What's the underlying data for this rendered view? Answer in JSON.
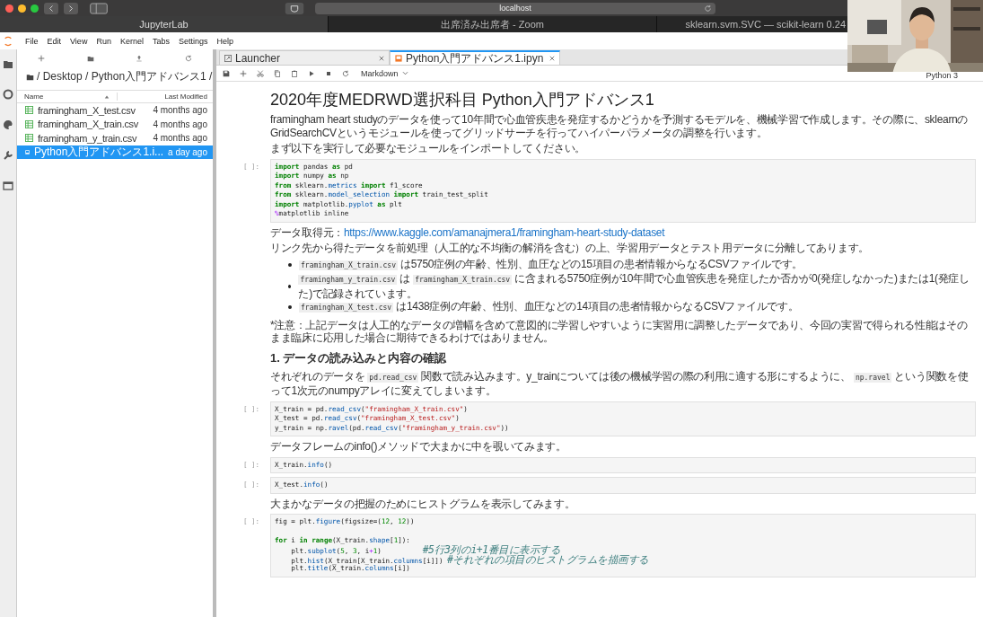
{
  "browser": {
    "address": "localhost",
    "tabs": [
      {
        "label": "JupyterLab",
        "selected": true
      },
      {
        "label": "出席済み出席者 - Zoom",
        "selected": false
      },
      {
        "label": "sklearn.svm.SVC — scikit-learn 0.24",
        "selected": false
      }
    ]
  },
  "menu": [
    "File",
    "Edit",
    "View",
    "Run",
    "Kernel",
    "Tabs",
    "Settings",
    "Help"
  ],
  "file_browser": {
    "breadcrumb": "/ Desktop / Python入門アドバンス1 /",
    "columns": [
      "Name",
      "Last Modified"
    ],
    "rows": [
      {
        "name": "framingham_X_test.csv",
        "modified": "4 months ago",
        "kind": "csv",
        "selected": false
      },
      {
        "name": "framingham_X_train.csv",
        "modified": "4 months ago",
        "kind": "csv",
        "selected": false
      },
      {
        "name": "framingham_y_train.csv",
        "modified": "4 months ago",
        "kind": "csv",
        "selected": false
      },
      {
        "name": "Python入門アドバンス1.i...",
        "modified": "a day ago",
        "kind": "notebook",
        "selected": true
      }
    ]
  },
  "doc_tabs": [
    {
      "label": "Launcher",
      "kind": "launcher",
      "selected": false
    },
    {
      "label": "Python入門アドバンス1.ipyn",
      "kind": "notebook",
      "selected": true
    }
  ],
  "toolbar": {
    "cell_type": "Markdown",
    "kernel": "Python 3"
  },
  "cells": [
    {
      "kind": "heading",
      "text": "2020年度MEDRWD選択科目 Python入門アドバンス1"
    },
    {
      "kind": "markdown",
      "paragraphs": [
        [
          {
            "t": "framingham heart studyのデータを使って10年間で心血管疾患を発症するかどうかを予測するモデルを、機械学習で作成します。その際に、sklearnのGridSearchCVというモジュールを使ってグリッドサーチを行ってハイパーパラメータの調整を行います。",
            "kind": "text"
          }
        ],
        [
          {
            "t": "まず以下を実行して必要なモジュールをインポートしてください。",
            "kind": "text"
          }
        ]
      ]
    },
    {
      "kind": "code",
      "prompt": "[ ]:",
      "lines": [
        {
          "tokens": [
            {
              "t": "import",
              "kind": "kw"
            },
            {
              "t": " pandas ",
              "kind": "plain"
            },
            {
              "t": "as",
              "kind": "kw"
            },
            {
              "t": " pd",
              "kind": "plain"
            }
          ]
        },
        {
          "tokens": [
            {
              "t": "import",
              "kind": "kw"
            },
            {
              "t": " numpy ",
              "kind": "plain"
            },
            {
              "t": "as",
              "kind": "kw"
            },
            {
              "t": " np",
              "kind": "plain"
            }
          ]
        },
        {
          "tokens": [
            {
              "t": "from",
              "kind": "kw"
            },
            {
              "t": " sklearn.",
              "kind": "plain"
            },
            {
              "t": "metrics",
              "kind": "attr"
            },
            {
              "t": " import",
              "kind": "kw"
            },
            {
              "t": " f1_score",
              "kind": "plain"
            }
          ]
        },
        {
          "tokens": [
            {
              "t": "from",
              "kind": "kw"
            },
            {
              "t": " sklearn.",
              "kind": "plain"
            },
            {
              "t": "model_selection",
              "kind": "attr"
            },
            {
              "t": " import",
              "kind": "kw"
            },
            {
              "t": " train_test_split",
              "kind": "plain"
            }
          ]
        },
        {
          "tokens": [
            {
              "t": "import",
              "kind": "kw"
            },
            {
              "t": " matplotlib.",
              "kind": "plain"
            },
            {
              "t": "pyplot",
              "kind": "attr"
            },
            {
              "t": " as",
              "kind": "kw"
            },
            {
              "t": " plt",
              "kind": "plain"
            }
          ]
        },
        {
          "tokens": [
            {
              "t": "%",
              "kind": "op"
            },
            {
              "t": "matplotlib inline",
              "kind": "plain"
            }
          ]
        }
      ]
    },
    {
      "kind": "markdown",
      "paragraphs": [
        [
          {
            "t": "データ取得元：",
            "kind": "text"
          },
          {
            "t": "https://www.kaggle.com/amanajmera1/framingham-heart-study-dataset",
            "kind": "link"
          }
        ],
        [
          {
            "t": "リンク先から得たデータを前処理（人工的な不均衡の解消を含む）の上、学習用データとテスト用データに分離してあります。",
            "kind": "text"
          }
        ]
      ]
    },
    {
      "kind": "list",
      "items": [
        [
          {
            "t": "framingham_X_train.csv",
            "kind": "code"
          },
          {
            "t": " は5750症例の年齢、性別、血圧などの15項目の患者情報からなるCSVファイルです。",
            "kind": "text"
          }
        ],
        [
          {
            "t": "framingham_y_train.csv",
            "kind": "code"
          },
          {
            "t": " は ",
            "kind": "text"
          },
          {
            "t": "framingham_X_train.csv",
            "kind": "code"
          },
          {
            "t": " に含まれる5750症例が10年間で心血管疾患を発症したか否かが0(発症しなかった)または1(発症した)で記録されています。",
            "kind": "text"
          }
        ],
        [
          {
            "t": "framingham_X_test.csv",
            "kind": "code"
          },
          {
            "t": " は1438症例の年齢、性別、血圧などの14項目の患者情報からなるCSVファイルです。",
            "kind": "text"
          }
        ]
      ]
    },
    {
      "kind": "markdown",
      "paragraphs": [
        [
          {
            "t": "*注意：上記データは人工的なデータの増幅を含めて意図的に学習しやすいように実習用に調整したデータであり、今回の実習で得られる性能はそのまま臨床に応用した場合に期待できるわけではありません。",
            "kind": "text"
          }
        ]
      ]
    },
    {
      "kind": "subheading",
      "text": "1. データの読み込みと内容の確認"
    },
    {
      "kind": "markdown",
      "paragraphs": [
        [
          {
            "t": "それぞれのデータを ",
            "kind": "text"
          },
          {
            "t": "pd.read_csv",
            "kind": "code"
          },
          {
            "t": " 関数で読み込みます。y_trainについては後の機械学習の際の利用に適する形にするように、 ",
            "kind": "text"
          },
          {
            "t": "np.ravel",
            "kind": "code"
          },
          {
            "t": " という関数を使って1次元のnumpyアレイに変えてしまいます。",
            "kind": "text"
          }
        ]
      ]
    },
    {
      "kind": "code",
      "prompt": "[ ]:",
      "lines": [
        {
          "tokens": [
            {
              "t": "X_train = pd.",
              "kind": "plain"
            },
            {
              "t": "read_csv",
              "kind": "attr"
            },
            {
              "t": "(",
              "kind": "plain"
            },
            {
              "t": "\"framingham_X_train.csv\"",
              "kind": "str"
            },
            {
              "t": ")",
              "kind": "plain"
            }
          ]
        },
        {
          "tokens": [
            {
              "t": "X_test = pd.",
              "kind": "plain"
            },
            {
              "t": "read_csv",
              "kind": "attr"
            },
            {
              "t": "(",
              "kind": "plain"
            },
            {
              "t": "\"framingham_X_test.csv\"",
              "kind": "str"
            },
            {
              "t": ")",
              "kind": "plain"
            }
          ]
        },
        {
          "tokens": [
            {
              "t": "y_train = np.",
              "kind": "plain"
            },
            {
              "t": "ravel",
              "kind": "attr"
            },
            {
              "t": "(pd.",
              "kind": "plain"
            },
            {
              "t": "read_csv",
              "kind": "attr"
            },
            {
              "t": "(",
              "kind": "plain"
            },
            {
              "t": "\"framingham_y_train.csv\"",
              "kind": "str"
            },
            {
              "t": "))",
              "kind": "plain"
            }
          ]
        }
      ]
    },
    {
      "kind": "markdown",
      "paragraphs": [
        [
          {
            "t": "データフレームのinfo()メソッドで大まかに中を覗いてみます。",
            "kind": "text"
          }
        ]
      ]
    },
    {
      "kind": "code",
      "prompt": "[ ]:",
      "lines": [
        {
          "tokens": [
            {
              "t": "X_train.",
              "kind": "plain"
            },
            {
              "t": "info",
              "kind": "attr"
            },
            {
              "t": "()",
              "kind": "plain"
            }
          ]
        }
      ]
    },
    {
      "kind": "code",
      "prompt": "[ ]:",
      "lines": [
        {
          "tokens": [
            {
              "t": "X_test.",
              "kind": "plain"
            },
            {
              "t": "info",
              "kind": "attr"
            },
            {
              "t": "()",
              "kind": "plain"
            }
          ]
        }
      ]
    },
    {
      "kind": "markdown",
      "paragraphs": [
        [
          {
            "t": "大まかなデータの把握のためにヒストグラムを表示してみます。",
            "kind": "text"
          }
        ]
      ]
    },
    {
      "kind": "code",
      "prompt": "[ ]:",
      "lines": [
        {
          "tokens": [
            {
              "t": "fig = plt.",
              "kind": "plain"
            },
            {
              "t": "figure",
              "kind": "attr"
            },
            {
              "t": "(figsize=(",
              "kind": "plain"
            },
            {
              "t": "12",
              "kind": "num"
            },
            {
              "t": ", ",
              "kind": "plain"
            },
            {
              "t": "12",
              "kind": "num"
            },
            {
              "t": "))",
              "kind": "plain"
            }
          ]
        },
        {
          "blank_before": true,
          "tokens": [
            {
              "t": "for",
              "kind": "kw"
            },
            {
              "t": " i ",
              "kind": "plain"
            },
            {
              "t": "in",
              "kind": "kw"
            },
            {
              "t": " range",
              "kind": "kw"
            },
            {
              "t": "(X_train.",
              "kind": "plain"
            },
            {
              "t": "shape",
              "kind": "attr"
            },
            {
              "t": "[",
              "kind": "plain"
            },
            {
              "t": "1",
              "kind": "num"
            },
            {
              "t": "]):",
              "kind": "plain"
            }
          ]
        },
        {
          "tokens": [
            {
              "t": "    plt.",
              "kind": "plain"
            },
            {
              "t": "subplot",
              "kind": "attr"
            },
            {
              "t": "(",
              "kind": "plain"
            },
            {
              "t": "5",
              "kind": "num"
            },
            {
              "t": ", ",
              "kind": "plain"
            },
            {
              "t": "3",
              "kind": "num"
            },
            {
              "t": ", i",
              "kind": "plain"
            },
            {
              "t": "+",
              "kind": "op"
            },
            {
              "t": "1",
              "kind": "num"
            },
            {
              "t": ")          ",
              "kind": "plain"
            },
            {
              "t": "#5行3列のi+1番目に表示する",
              "kind": "com"
            }
          ]
        },
        {
          "tokens": [
            {
              "t": "    plt.",
              "kind": "plain"
            },
            {
              "t": "hist",
              "kind": "attr"
            },
            {
              "t": "(X_train[X_train.",
              "kind": "plain"
            },
            {
              "t": "columns",
              "kind": "attr"
            },
            {
              "t": "[i]]) ",
              "kind": "plain"
            },
            {
              "t": "#それぞれの項目のヒストグラムを描画する",
              "kind": "com"
            }
          ]
        },
        {
          "tokens": [
            {
              "t": "    plt.",
              "kind": "plain"
            },
            {
              "t": "title",
              "kind": "attr"
            },
            {
              "t": "(X_train.",
              "kind": "plain"
            },
            {
              "t": "columns",
              "kind": "attr"
            },
            {
              "t": "[i])",
              "kind": "plain"
            }
          ]
        }
      ]
    }
  ]
}
